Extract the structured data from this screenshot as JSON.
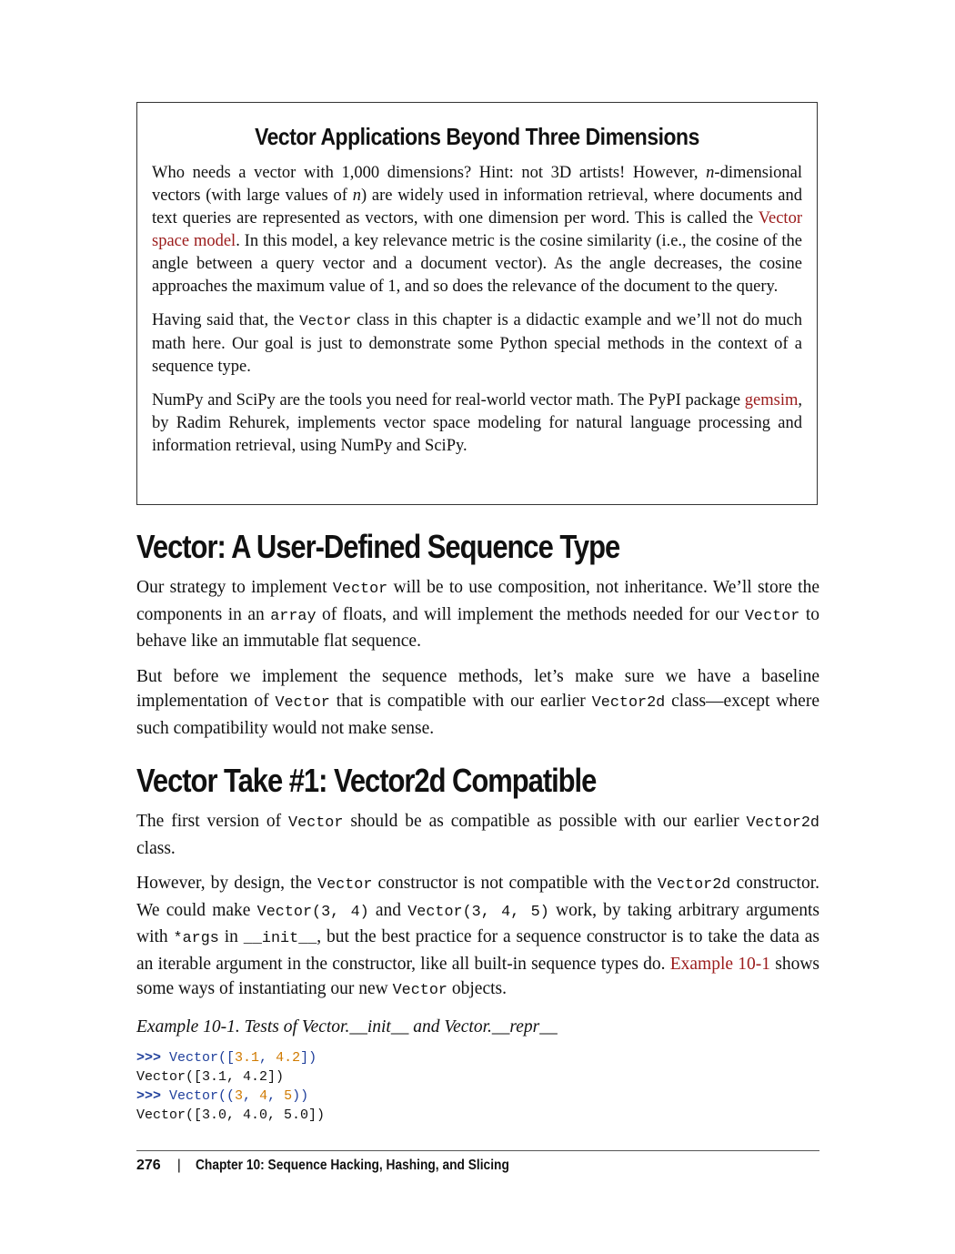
{
  "sidebar": {
    "title": "Vector Applications Beyond Three Dimensions",
    "p1_a": "Who needs a vector with 1,000 dimensions? Hint: not 3D artists! However, ",
    "p1_n1": "n",
    "p1_b": "-dimensional vectors (with large values of ",
    "p1_n2": "n",
    "p1_c": ") are widely used in information retrieval, where documents and text queries are represented as vectors, with one dimension per word. This is called the ",
    "p1_link": "Vector space model",
    "p1_d": ". In this model, a key relevance metric is the cosine similarity (i.e., the cosine of the angle between a query vector and a document vector). As the angle decreases, the cosine approaches the maximum value of 1, and so does the relevance of the document to the query.",
    "p2_a": "Having said that, the ",
    "p2_code": "Vector",
    "p2_b": " class in this chapter is a didactic example and we’ll not do much math here. Our goal is just to demonstrate some Python special methods in the context of a sequence type.",
    "p3_a": "NumPy and SciPy are the tools you need for real-world vector math. The PyPI package ",
    "p3_link": "gemsim",
    "p3_b": ", by Radim Rehurek, implements vector space modeling for natural language processing and information retrieval, using NumPy and SciPy."
  },
  "section1": {
    "heading": "Vector: A User-Defined Sequence Type",
    "p1_a": "Our strategy to implement ",
    "p1_c1": "Vector",
    "p1_b": " will be to use composition, not inheritance. We’ll store the components in an ",
    "p1_c2": "array",
    "p1_c": " of floats, and will implement the methods needed for our ",
    "p1_c3": "Vector",
    "p1_d": " to behave like an immutable flat sequence.",
    "p2_a": "But before we implement the sequence methods, let’s make sure we have a baseline implementation of ",
    "p2_c1": "Vector",
    "p2_b": " that is compatible with our earlier ",
    "p2_c2": "Vector2d",
    "p2_c": " class—except where such compatibility would not make sense."
  },
  "section2": {
    "heading": "Vector Take #1: Vector2d Compatible",
    "p1_a": "The first version of ",
    "p1_c1": "Vector",
    "p1_b": " should be as compatible as possible with our earlier ",
    "p1_c2": "Vector2d",
    "p1_c": " class.",
    "p2_a": "However, by design, the ",
    "p2_c1": "Vector",
    "p2_b": " constructor is not compatible with the ",
    "p2_c2": "Vector2d",
    "p2_c": " constructor. We could make ",
    "p2_c3": "Vector(3, 4)",
    "p2_d": " and ",
    "p2_c4": "Vector(3, 4, 5)",
    "p2_e": " work, by taking arbitrary arguments with ",
    "p2_c5": "*args",
    "p2_f": " in ",
    "p2_c6": "__init__",
    "p2_g": ", but the best practice for a sequence constructor is to take the data as an iterable argument in the constructor, like all built-in sequence types do. ",
    "p2_link": "Example 10-1",
    "p2_h": " shows some ways of instantiating our new ",
    "p2_c7": "Vector",
    "p2_i": " objects.",
    "caption": "Example 10-1. Tests of Vector.__init__ and Vector.__repr__",
    "code": {
      "l1_prompt": ">>>",
      "l1_a": " Vector([",
      "l1_n1": "3.1",
      "l1_b": ", ",
      "l1_n2": "4.2",
      "l1_c": "])",
      "l2": "Vector([3.1, 4.2])",
      "l3_prompt": ">>>",
      "l3_a": " Vector((",
      "l3_n1": "3",
      "l3_b": ", ",
      "l3_n2": "4",
      "l3_c": ", ",
      "l3_n3": "5",
      "l3_d": "))",
      "l4": "Vector([3.0, 4.0, 5.0])"
    }
  },
  "footer": {
    "page_number": "276",
    "separator": "|",
    "chapter": "Chapter 10: Sequence Hacking, Hashing, and Slicing"
  }
}
